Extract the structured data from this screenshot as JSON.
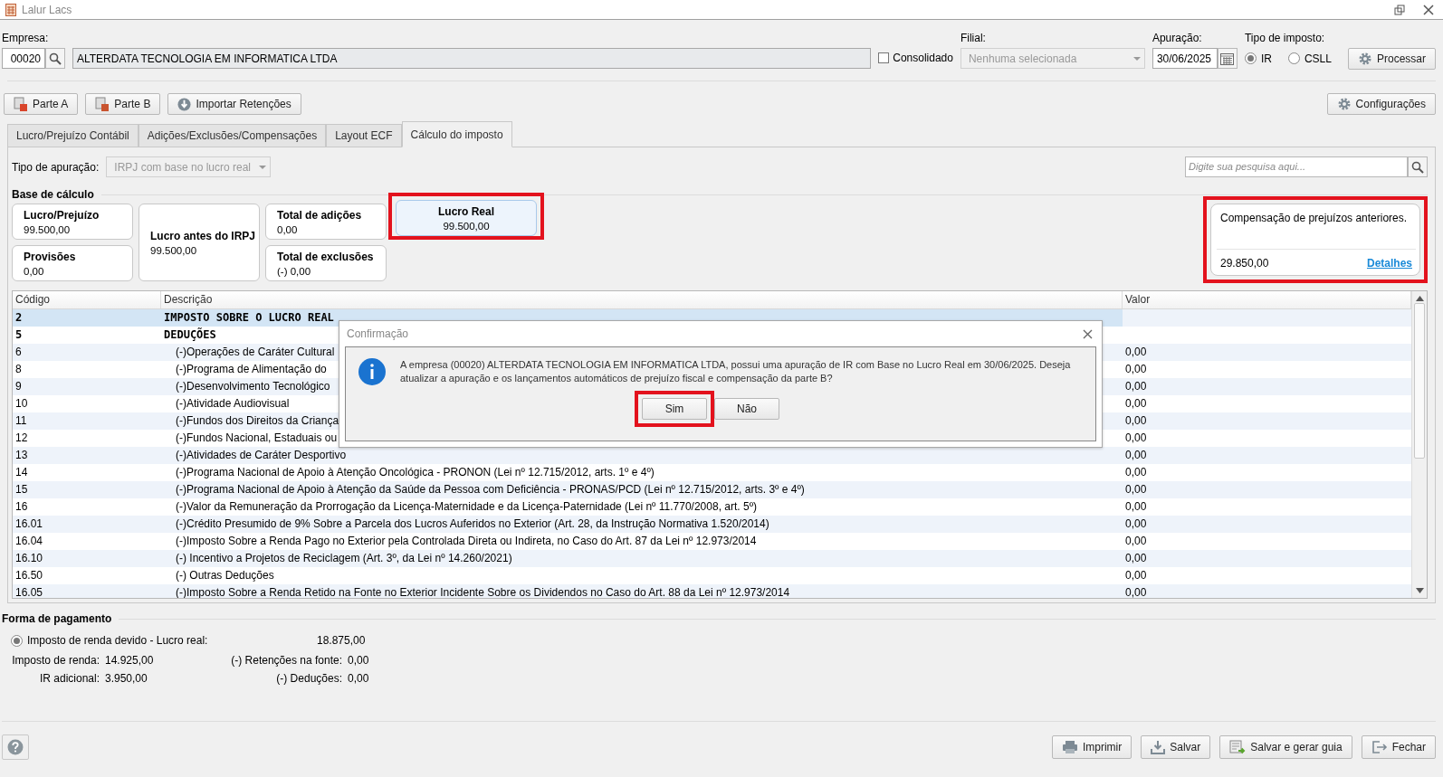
{
  "window": {
    "title": "Lalur Lacs"
  },
  "header": {
    "empresa_label": "Empresa:",
    "empresa_code": "00020",
    "empresa_name": "ALTERDATA TECNOLOGIA EM INFORMATICA LTDA",
    "consolidado": {
      "label": "Consolidado",
      "checked": false
    },
    "filial_label": "Filial:",
    "filial_value": "Nenhuma selecionada",
    "apuracao_label": "Apuração:",
    "apuracao_value": "30/06/2025",
    "tipo_label": "Tipo de imposto:",
    "tipo_options": [
      {
        "label": "IR",
        "selected": true
      },
      {
        "label": "CSLL",
        "selected": false
      }
    ],
    "process_button": "Processar"
  },
  "toolbar": {
    "buttons": [
      {
        "label": "Parte A",
        "kind": "parta"
      },
      {
        "label": "Parte B",
        "kind": "partb"
      },
      {
        "label": "Importar Retenções",
        "kind": "import"
      }
    ],
    "settings_button": "Configurações"
  },
  "tabs": [
    {
      "label": "Lucro/Prejuízo Contábil",
      "selected": false
    },
    {
      "label": "Adições/Exclusões/Compensações",
      "selected": false
    },
    {
      "label": "Layout ECF",
      "selected": false
    },
    {
      "label": "Cálculo do imposto",
      "selected": true
    }
  ],
  "panel": {
    "tipo_label": "Tipo de apuração:",
    "tipo_value": "IRPJ com base no lucro real",
    "search_placeholder": "Digite sua pesquisa aqui...",
    "base_heading": "Base de cálculo",
    "cards": [
      {
        "title": "Lucro/Prejuízo",
        "value": "99.500,00",
        "selected": false,
        "highlighted": false
      },
      {
        "title": "Provisões",
        "value": "0,00",
        "selected": false,
        "highlighted": false
      },
      {
        "title": "Lucro antes do IRPJ",
        "value": "99.500,00",
        "selected": false,
        "highlighted": false
      },
      {
        "title": "Total de adições",
        "value": "0,00",
        "selected": false,
        "highlighted": false
      },
      {
        "title": "Total de exclusões",
        "value": "(-) 0,00",
        "selected": false,
        "highlighted": false
      },
      {
        "title": "Lucro Real",
        "value": "99.500,00",
        "selected": true,
        "highlighted": true
      }
    ],
    "compensation": {
      "title": "Compensação de prejuízos anteriores.",
      "value": "29.850,00",
      "link": "Detalhes",
      "highlighted": true
    }
  },
  "table": {
    "columns": [
      "Código",
      "Descrição",
      "Valor"
    ],
    "rows": [
      {
        "code": "2",
        "description": "IMPOSTO SOBRE O LUCRO REAL",
        "kind": "group",
        "selected": true
      },
      {
        "code": "5",
        "description": "DEDUÇÕES",
        "kind": "group",
        "selected": false
      },
      {
        "code": "6",
        "description": "(-)Operações de Caráter Cultural",
        "value": "0,00",
        "kind": "item",
        "selected": false
      },
      {
        "code": "8",
        "description": "(-)Programa de Alimentação do",
        "value": "0,00",
        "kind": "item",
        "selected": false
      },
      {
        "code": "9",
        "description": "(-)Desenvolvimento Tecnológico",
        "value": "0,00",
        "kind": "item",
        "selected": false
      },
      {
        "code": "10",
        "description": "(-)Atividade Audiovisual",
        "value": "0,00",
        "kind": "item",
        "selected": false
      },
      {
        "code": "11",
        "description": "(-)Fundos dos Direitos da Criança",
        "value": "0,00",
        "kind": "item",
        "selected": false
      },
      {
        "code": "12",
        "description": "(-)Fundos Nacional, Estaduais ou",
        "value": "0,00",
        "kind": "item",
        "selected": false
      },
      {
        "code": "13",
        "description": "(-)Atividades de Caráter Desportivo",
        "value": "0,00",
        "kind": "item",
        "selected": false
      },
      {
        "code": "14",
        "description": "(-)Programa Nacional de Apoio à Atenção Oncológica - PRONON (Lei nº 12.715/2012, arts. 1º e 4º)",
        "value": "0,00",
        "kind": "item",
        "selected": false
      },
      {
        "code": "15",
        "description": "(-)Programa Nacional de Apoio à Atenção da Saúde da Pessoa com Deficiência - PRONAS/PCD (Lei nº 12.715/2012, arts. 3º e 4º)",
        "value": "0,00",
        "kind": "item",
        "selected": false
      },
      {
        "code": "16",
        "description": "(-)Valor da Remuneração da Prorrogação da Licença-Maternidade e da Licença-Paternidade (Lei nº 11.770/2008, art. 5º)",
        "value": "0,00",
        "kind": "item",
        "selected": false
      },
      {
        "code": "16.01",
        "description": "(-)Crédito Presumido de 9% Sobre a Parcela dos Lucros Auferidos no Exterior (Art. 28, da Instrução Normativa 1.520/2014)",
        "value": "0,00",
        "kind": "item",
        "selected": false
      },
      {
        "code": "16.04",
        "description": "(-)Imposto Sobre a Renda Pago no Exterior pela Controlada Direta ou Indireta, no Caso do Art. 87 da Lei nº 12.973/2014",
        "value": "0,00",
        "kind": "item",
        "selected": false
      },
      {
        "code": "16.10",
        "description": "(-) Incentivo a Projetos de Reciclagem (Art. 3º, da Lei nº 14.260/2021)",
        "value": "0,00",
        "kind": "item",
        "selected": false
      },
      {
        "code": "16.50",
        "description": "(-) Outras Deduções",
        "value": "0,00",
        "kind": "item",
        "selected": false
      },
      {
        "code": "16.05",
        "description": "(-)Imposto Sobre a Renda Retido na Fonte no Exterior Incidente Sobre os Dividendos no Caso do Art. 88 da Lei nº 12.973/2014",
        "value": "0,00",
        "kind": "item",
        "selected": false
      }
    ]
  },
  "payment": {
    "heading": "Forma de pagamento",
    "option": {
      "label": "Imposto de renda devido - Lucro real:",
      "selected": true
    },
    "total": "18.875,00",
    "left": [
      {
        "label": "Imposto de renda:",
        "value": "14.925,00"
      },
      {
        "label": "IR adicional:",
        "value": "3.950,00"
      }
    ],
    "right": [
      {
        "label": "(-) Retenções na fonte:",
        "value": "0,00"
      },
      {
        "label": "(-) Deduções:",
        "value": "0,00"
      }
    ]
  },
  "footer": {
    "buttons": [
      {
        "label": "Imprimir",
        "kind": "print"
      },
      {
        "label": "Salvar",
        "kind": "save"
      },
      {
        "label": "Salvar e gerar guia",
        "kind": "guide"
      },
      {
        "label": "Fechar",
        "kind": "exit"
      }
    ]
  },
  "dialog": {
    "title": "Confirmação",
    "message": "A empresa (00020) ALTERDATA TECNOLOGIA EM INFORMATICA LTDA, possui uma apuração de IR com Base no Lucro Real em 30/06/2025. Deseja atualizar a apuração e os lançamentos automáticos de prejuízo fiscal e compensação da parte B?",
    "buttons": [
      {
        "label": "Sim",
        "highlighted": true
      },
      {
        "label": "Não",
        "highlighted": false
      }
    ]
  }
}
